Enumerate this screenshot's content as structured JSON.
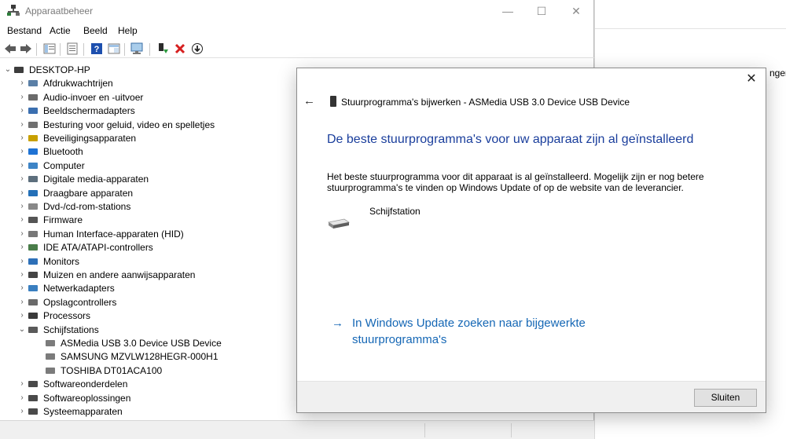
{
  "window": {
    "title": "Apparaatbeheer"
  },
  "menu": [
    "Bestand",
    "Actie",
    "Beeld",
    "Help"
  ],
  "tree": {
    "root": "DESKTOP-HP",
    "categories": [
      "Afdrukwachtrijen",
      "Audio-invoer en -uitvoer",
      "Beeldschermadapters",
      "Besturing voor geluid, video en spelletjes",
      "Beveiligingsapparaten",
      "Bluetooth",
      "Computer",
      "Digitale media-apparaten",
      "Draagbare apparaten",
      "Dvd-/cd-rom-stations",
      "Firmware",
      "Human Interface-apparaten (HID)",
      "IDE ATA/ATAPI-controllers",
      "Monitors",
      "Muizen en andere aanwijsapparaten",
      "Netwerkadapters",
      "Opslagcontrollers",
      "Processors",
      "Schijfstations"
    ],
    "schijf_children": [
      "ASMedia USB 3.0 Device USB Device",
      "SAMSUNG MZVLW128HEGR-000H1",
      "TOSHIBA DT01ACA100"
    ],
    "after": [
      "Softwareonderdelen",
      "Softwareoplossingen",
      "Systeemapparaten"
    ]
  },
  "background": {
    "fragment": "nger"
  },
  "dialog": {
    "header": "Stuurprogramma's bijwerken - ASMedia USB 3.0 Device USB Device",
    "heading": "De beste stuurprogramma's voor uw apparaat zijn al geïnstalleerd",
    "body_line1": "Het beste stuurprogramma voor dit apparaat is al geïnstalleerd. Mogelijk zijn er nog betere",
    "body_line2": "stuurprogramma's te vinden op Windows Update of op de website van de leverancier.",
    "device": "Schijfstation",
    "link_line1": "In Windows Update zoeken naar bijgewerkte",
    "link_line2": "stuurprogramma's",
    "close_button": "Sluiten"
  },
  "colors": {
    "heading": "#1a3e9c",
    "link": "#1567b5"
  }
}
